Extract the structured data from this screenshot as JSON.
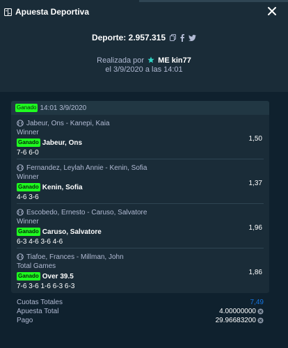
{
  "header": {
    "title": "Apuesta Deportiva",
    "close_icon": "close-icon"
  },
  "summary": {
    "deporte": "Deporte: 2.957.315",
    "placed_by_label": "Realizada por",
    "user": "ME kin77",
    "date_line": "el 3/9/2020 a las 14:01"
  },
  "bet": {
    "status": "Ganado",
    "datetime": "14:01 3/9/2020",
    "legs": [
      {
        "event": "Jabeur, Ons - Kanepi, Kaia",
        "market": "Winner",
        "status": "Ganado",
        "pick": "Jabeur, Ons",
        "odds": "1,50",
        "score": "7-6 6-0"
      },
      {
        "event": "Fernandez, Leylah Annie - Kenin, Sofia",
        "market": "Winner",
        "status": "Ganado",
        "pick": "Kenin, Sofia",
        "odds": "1,37",
        "score": "4-6 3-6"
      },
      {
        "event": "Escobedo, Ernesto - Caruso, Salvatore",
        "market": "Winner",
        "status": "Ganado",
        "pick": "Caruso, Salvatore",
        "odds": "1,96",
        "score": "6-3 4-6 3-6 4-6"
      },
      {
        "event": "Tiafoe, Frances - Millman, John",
        "market": "Total Games",
        "status": "Ganado",
        "pick": "Over 39.5",
        "odds": "1,86",
        "score": "7-6 3-6 1-6 6-3 6-3"
      }
    ]
  },
  "totals": {
    "odds_label": "Cuotas Totales",
    "odds_value": "7,49",
    "stake_label": "Apuesta Total",
    "stake_value": "4.00000000",
    "payout_label": "Pago",
    "payout_value": "29.96683200"
  },
  "colors": {
    "accent": "#1475e1",
    "win": "#1fff20",
    "panel": "#1a2c38",
    "bg": "#0f212e"
  }
}
